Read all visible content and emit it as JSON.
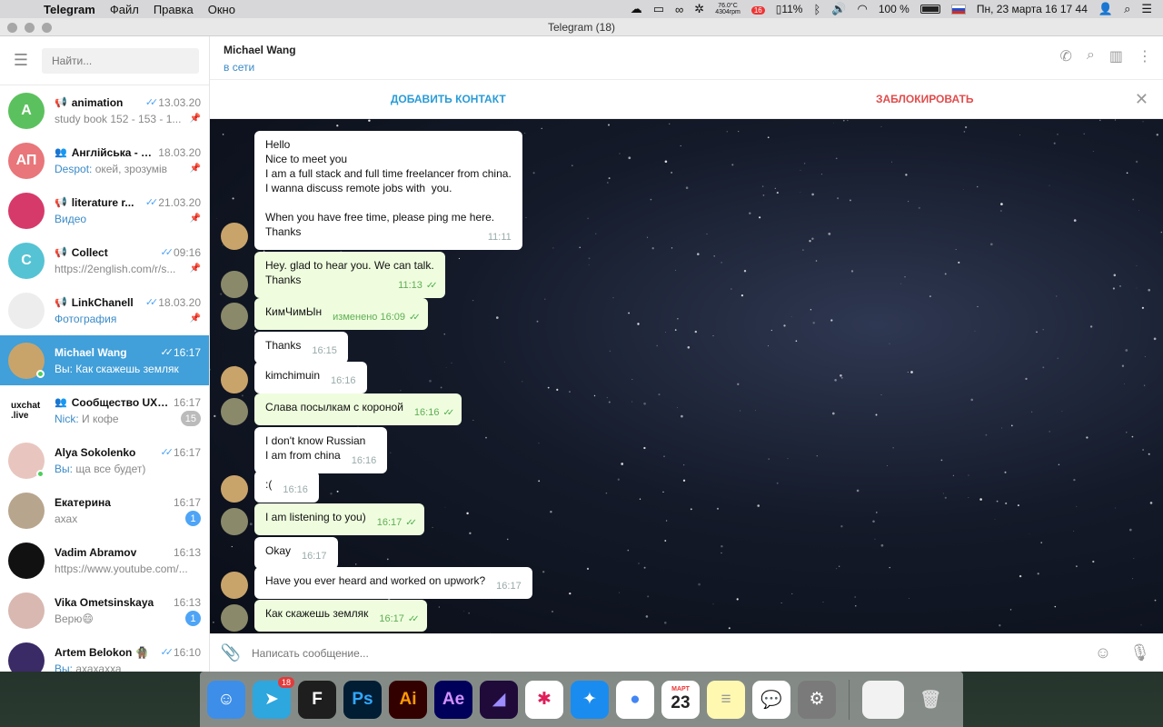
{
  "menubar": {
    "app": "Telegram",
    "menus": [
      "Файл",
      "Правка",
      "Окно"
    ],
    "temp": "76.0°C",
    "rpm": "4304rpm",
    "notif_badge": "16",
    "battery_small": "11%",
    "battery": "100 %",
    "datetime": "Пн, 23 марта  16 17 44"
  },
  "window": {
    "title": "Telegram (18)"
  },
  "sidebar": {
    "search_placeholder": "Найти...",
    "chats": [
      {
        "name": "animation",
        "time": "13.03.20",
        "preview": "study book 152 - 153 - 1...",
        "who": "",
        "avatar_text": "A",
        "avatar_color": "#5bc15e",
        "kind": "channel",
        "ticks": true,
        "pinned": true
      },
      {
        "name": "Англійська - п...",
        "time": "18.03.20",
        "preview": "окей, зрозумів",
        "who": "Despot:",
        "avatar_text": "АП",
        "avatar_color": "#e8767a",
        "kind": "group",
        "ticks": false,
        "pinned": true
      },
      {
        "name": "literature r...",
        "time": "21.03.20",
        "preview": "",
        "who": "Видео",
        "avatar_text": "",
        "avatar_color": "#d63a6a",
        "kind": "channel",
        "ticks": true,
        "pinned": true
      },
      {
        "name": "Collect",
        "time": "09:16",
        "preview": "https://2english.com/r/s...",
        "who": "",
        "avatar_text": "C",
        "avatar_color": "#55c3d3",
        "kind": "channel",
        "ticks": true,
        "pinned": true
      },
      {
        "name": "LinkChanell",
        "time": "18.03.20",
        "preview": "",
        "who": "Фотография",
        "avatar_text": "",
        "avatar_color": "#ededed",
        "kind": "channel",
        "ticks": true,
        "pinned": true
      },
      {
        "name": "Michael Wang",
        "time": "16:17",
        "preview": "Вы: Как скажешь земляк",
        "who": "",
        "avatar_text": "",
        "avatar_color": "#c9a46a",
        "kind": "user",
        "ticks": true,
        "active": true,
        "online": true
      },
      {
        "name": "Сообщество UX /...",
        "time": "16:17",
        "preview": "И кофе",
        "who": "Nick:",
        "avatar_text": "uxchat .live",
        "avatar_color": "#ffffff",
        "kind": "group",
        "ticks": false,
        "unread": "15",
        "muted": true
      },
      {
        "name": "Alya Sokolenko",
        "time": "16:17",
        "preview": "ща все будет)",
        "who": "Вы:",
        "avatar_text": "",
        "avatar_color": "#e8c6bf",
        "kind": "user",
        "ticks": true,
        "online": true
      },
      {
        "name": "Екатерина",
        "time": "16:17",
        "preview": "ахах",
        "who": "",
        "avatar_text": "",
        "avatar_color": "#b7a58d",
        "kind": "user",
        "ticks": false,
        "unread": "1"
      },
      {
        "name": "Vadim Abramov",
        "time": "16:13",
        "preview": "https://www.youtube.com/...",
        "who": "",
        "avatar_text": "",
        "avatar_color": "#111111",
        "kind": "user",
        "ticks": false
      },
      {
        "name": "Vika Ometsinskaya",
        "time": "16:13",
        "preview": "Верю😄",
        "who": "",
        "avatar_text": "",
        "avatar_color": "#d8b8b0",
        "kind": "user",
        "ticks": false,
        "unread": "1"
      },
      {
        "name": "Artem Belokon 🧌",
        "time": "16:10",
        "preview": "ахахахха",
        "who": "Вы:",
        "avatar_text": "",
        "avatar_color": "#3a2a66",
        "kind": "user",
        "ticks": true
      }
    ]
  },
  "chat": {
    "title": "Michael Wang",
    "status": "в сети",
    "add_contact": "ДОБАВИТЬ КОНТАКТ",
    "block": "ЗАБЛОКИРОВАТЬ",
    "composer_placeholder": "Написать сообщение...",
    "messages": [
      {
        "text": "Hello\nNice to meet you\nI am a full stack and full time freelancer from china.\nI wanna discuss remote jobs with  you.\n\nWhen you have free time, please ping me here.\nThanks",
        "time": "11:11",
        "out": false,
        "avatar": true
      },
      {
        "text": "Hey. glad to hear you. We can talk.\nThanks",
        "time": "11:13",
        "out": true,
        "avatar": true
      },
      {
        "text": "КимЧимЫн",
        "time": "изменено 16:09",
        "out": true,
        "avatar": true
      },
      {
        "text": "Thanks",
        "time": "16:15",
        "out": false,
        "avatar": false
      },
      {
        "text": "kimchimuin",
        "time": "16:16",
        "out": false,
        "avatar": true
      },
      {
        "text": "Слава посылкам с короной",
        "time": "16:16",
        "out": true,
        "avatar": true
      },
      {
        "text": "I don't know Russian\nI am from china",
        "time": "16:16",
        "out": false,
        "avatar": false
      },
      {
        "text": ":(",
        "time": "16:16",
        "out": false,
        "avatar": true
      },
      {
        "text": "I am listening to you)",
        "time": "16:17",
        "out": true,
        "avatar": true
      },
      {
        "text": "Okay",
        "time": "16:17",
        "out": false,
        "avatar": false
      },
      {
        "text": "Have you ever heard and worked on upwork?",
        "time": "16:17",
        "out": false,
        "avatar": true
      },
      {
        "text": "Как скажешь земляк",
        "time": "16:17",
        "out": true,
        "avatar": true
      }
    ]
  },
  "dock": {
    "apps": [
      {
        "name": "Finder",
        "label": "☺",
        "color": "#3d8ee9"
      },
      {
        "name": "Telegram",
        "label": "➤",
        "color": "#2ea6de",
        "badge": "18"
      },
      {
        "name": "Figma",
        "label": "F",
        "color": "#1e1e1e"
      },
      {
        "name": "Photoshop",
        "label": "Ps",
        "color": "#001d34",
        "text_color": "#31a8ff"
      },
      {
        "name": "Illustrator",
        "label": "Ai",
        "color": "#330000",
        "text_color": "#ff9a00"
      },
      {
        "name": "After Effects",
        "label": "Ae",
        "color": "#00005b",
        "text_color": "#d291ff"
      },
      {
        "name": "Media Encoder",
        "label": "◢",
        "color": "#1f0a3a",
        "text_color": "#9b8cff"
      },
      {
        "name": "Slack",
        "label": "✱",
        "color": "#ffffff",
        "text_color": "#e01e5a"
      },
      {
        "name": "Safari",
        "label": "✦",
        "color": "#1a8cf0"
      },
      {
        "name": "Chrome",
        "label": "●",
        "color": "#ffffff",
        "text_color": "#4285f4"
      },
      {
        "name": "Calendar",
        "label": "23",
        "color": "#ffffff",
        "text_color": "#222222",
        "sub": "МАРТ"
      },
      {
        "name": "Notes",
        "label": "≡",
        "color": "#fff8b0",
        "text_color": "#999999"
      },
      {
        "name": "Messages",
        "label": "💬",
        "color": "#ffffff"
      },
      {
        "name": "System Preferences",
        "label": "⚙",
        "color": "#7a7a7a"
      }
    ]
  }
}
